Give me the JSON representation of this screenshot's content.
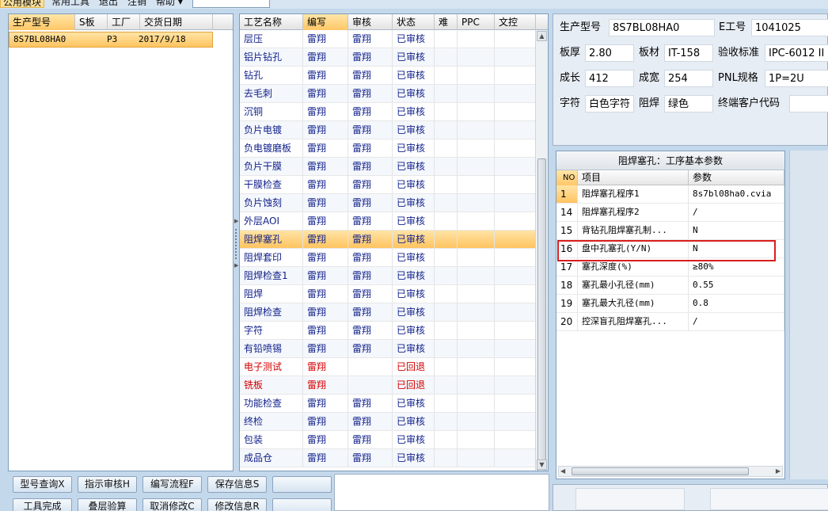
{
  "menu": {
    "items": [
      {
        "label": "公用模块",
        "active": true
      },
      {
        "label": "常用工具",
        "active": false
      },
      {
        "label": "退出",
        "active": false
      },
      {
        "label": "注销",
        "active": false
      },
      {
        "label": "帮助 ▾",
        "active": false
      }
    ]
  },
  "left_grid": {
    "headers": [
      "生产型号",
      "S板",
      "工厂",
      "交货日期"
    ],
    "rows": [
      {
        "model": "8S7BL08HA0",
        "s": "",
        "factory": "P3",
        "date": "2017/9/18"
      }
    ]
  },
  "process_grid": {
    "headers": [
      "工艺名称",
      "编写",
      "审核",
      "状态",
      "难",
      "PPC",
      "文控"
    ],
    "selected_index": 11,
    "rows": [
      {
        "name": "层压",
        "writer": "雷翔",
        "reviewer": "雷翔",
        "status": "已审核",
        "flag": "normal"
      },
      {
        "name": "铝片钻孔",
        "writer": "雷翔",
        "reviewer": "雷翔",
        "status": "已审核",
        "flag": "normal"
      },
      {
        "name": "钻孔",
        "writer": "雷翔",
        "reviewer": "雷翔",
        "status": "已审核",
        "flag": "normal"
      },
      {
        "name": "去毛刺",
        "writer": "雷翔",
        "reviewer": "雷翔",
        "status": "已审核",
        "flag": "normal"
      },
      {
        "name": "沉铜",
        "writer": "雷翔",
        "reviewer": "雷翔",
        "status": "已审核",
        "flag": "normal"
      },
      {
        "name": "负片电镀",
        "writer": "雷翔",
        "reviewer": "雷翔",
        "status": "已审核",
        "flag": "normal"
      },
      {
        "name": "负电镀磨板",
        "writer": "雷翔",
        "reviewer": "雷翔",
        "status": "已审核",
        "flag": "normal"
      },
      {
        "name": "负片干膜",
        "writer": "雷翔",
        "reviewer": "雷翔",
        "status": "已审核",
        "flag": "normal"
      },
      {
        "name": "干膜检查",
        "writer": "雷翔",
        "reviewer": "雷翔",
        "status": "已审核",
        "flag": "normal"
      },
      {
        "name": "负片蚀刻",
        "writer": "雷翔",
        "reviewer": "雷翔",
        "status": "已审核",
        "flag": "normal"
      },
      {
        "name": "外层AOI",
        "writer": "雷翔",
        "reviewer": "雷翔",
        "status": "已审核",
        "flag": "normal"
      },
      {
        "name": "阻焊塞孔",
        "writer": "雷翔",
        "reviewer": "雷翔",
        "status": "已审核",
        "flag": "normal"
      },
      {
        "name": "阻焊套印",
        "writer": "雷翔",
        "reviewer": "雷翔",
        "status": "已审核",
        "flag": "normal"
      },
      {
        "name": "阻焊检查1",
        "writer": "雷翔",
        "reviewer": "雷翔",
        "status": "已审核",
        "flag": "normal"
      },
      {
        "name": "阻焊",
        "writer": "雷翔",
        "reviewer": "雷翔",
        "status": "已审核",
        "flag": "normal"
      },
      {
        "name": "阻焊检查",
        "writer": "雷翔",
        "reviewer": "雷翔",
        "status": "已审核",
        "flag": "normal"
      },
      {
        "name": "字符",
        "writer": "雷翔",
        "reviewer": "雷翔",
        "status": "已审核",
        "flag": "normal"
      },
      {
        "name": "有铅喷锡",
        "writer": "雷翔",
        "reviewer": "雷翔",
        "status": "已审核",
        "flag": "normal"
      },
      {
        "name": "电子测试",
        "writer": "雷翔",
        "reviewer": "",
        "status": "已回退",
        "flag": "returned"
      },
      {
        "name": "铣板",
        "writer": "雷翔",
        "reviewer": "",
        "status": "已回退",
        "flag": "returned"
      },
      {
        "name": "功能检查",
        "writer": "雷翔",
        "reviewer": "雷翔",
        "status": "已审核",
        "flag": "normal"
      },
      {
        "name": "终检",
        "writer": "雷翔",
        "reviewer": "雷翔",
        "status": "已审核",
        "flag": "normal"
      },
      {
        "name": "包装",
        "writer": "雷翔",
        "reviewer": "雷翔",
        "status": "已审核",
        "flag": "normal"
      },
      {
        "name": "成品仓",
        "writer": "雷翔",
        "reviewer": "雷翔",
        "status": "已审核",
        "flag": "normal"
      }
    ]
  },
  "info": {
    "model_label": "生产型号",
    "model_value": "8S7BL08HA0",
    "eng_label": "E工号",
    "eng_value": "1041025",
    "thickness_label": "板厚",
    "thickness_value": "2.80",
    "material_label": "板材",
    "material_value": "IT-158",
    "standard_label": "验收标准",
    "standard_value": "IPC-6012 II",
    "length_label": "成长",
    "length_value": "412",
    "width_label": "成宽",
    "width_value": "254",
    "pnl_label": "PNL规格",
    "pnl_value": "1P=2U",
    "char_label": "字符",
    "char_value": "白色字符",
    "mask_label": "阻焊",
    "mask_value": "绿色",
    "customer_label": "终端客户代码",
    "customer_value": ""
  },
  "params": {
    "title": "阻焊塞孔：工序基本参数",
    "headers": [
      "NO",
      "项目",
      "参数"
    ],
    "rows": [
      {
        "no": "1",
        "item": "阻焊塞孔程序1",
        "value": "8s7bl08ha0.cvia",
        "selected": true
      },
      {
        "no": "14",
        "item": "阻焊塞孔程序2",
        "value": "/",
        "selected": false
      },
      {
        "no": "15",
        "item": "背钻孔阻焊塞孔制...",
        "value": "N",
        "selected": false
      },
      {
        "no": "16",
        "item": "盘中孔塞孔(Y/N)",
        "value": "N",
        "selected": false
      },
      {
        "no": "17",
        "item": "塞孔深度(%)",
        "value": "≥80%",
        "selected": false
      },
      {
        "no": "18",
        "item": "塞孔最小孔径(mm)",
        "value": "0.55",
        "selected": false
      },
      {
        "no": "19",
        "item": "塞孔最大孔径(mm)",
        "value": "0.8",
        "selected": false
      },
      {
        "no": "20",
        "item": "控深盲孔阻焊塞孔...",
        "value": "/",
        "selected": false
      }
    ]
  },
  "buttons": {
    "model_query": "型号查询X",
    "instruct_review": "指示审核H",
    "write_flow": "编写流程F",
    "save_info": "保存信息S",
    "tool_done": "工具完成",
    "layer_calc": "叠层验算",
    "cancel_edit": "取消修改C",
    "edit_info": "修改信息R"
  },
  "colors": {
    "selection": "#ffc460",
    "returned": "#d40000",
    "user_text": "#0f1f8a",
    "highlight_box": "#d91e1e"
  }
}
